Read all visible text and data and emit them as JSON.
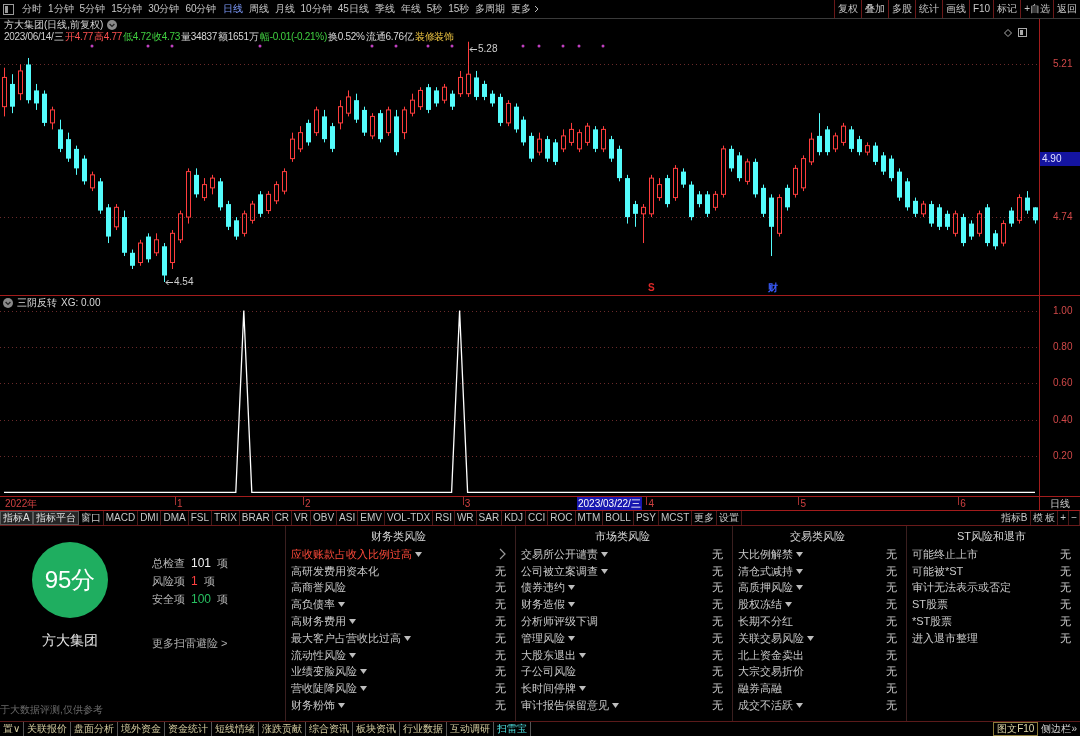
{
  "toolbar": {
    "periods": [
      {
        "label": "分时",
        "selected": false
      },
      {
        "label": "1分钟",
        "selected": false
      },
      {
        "label": "5分钟",
        "selected": false
      },
      {
        "label": "15分钟",
        "selected": false
      },
      {
        "label": "30分钟",
        "selected": false
      },
      {
        "label": "60分钟",
        "selected": false
      },
      {
        "label": "日线",
        "selected": true
      },
      {
        "label": "周线",
        "selected": false
      },
      {
        "label": "月线",
        "selected": false
      },
      {
        "label": "10分钟",
        "selected": false
      },
      {
        "label": "45日线",
        "selected": false
      },
      {
        "label": "季线",
        "selected": false
      },
      {
        "label": "年线",
        "selected": false
      },
      {
        "label": "5秒",
        "selected": false
      },
      {
        "label": "15秒",
        "selected": false
      },
      {
        "label": "多周期",
        "selected": false
      }
    ],
    "more": "更多",
    "actions": [
      "复权",
      "叠加",
      "多股",
      "统计",
      "画线",
      "F10",
      "标记",
      "+自选",
      "返回"
    ]
  },
  "main_pane": {
    "quote_date": "2023/06/14/三",
    "prices": [
      {
        "text": "开4.77",
        "color": "#ff5050"
      },
      {
        "text": "高4.77",
        "color": "#ff5050"
      },
      {
        "text": "低4.72",
        "color": "#40d040"
      },
      {
        "text": "收4.73",
        "color": "#40d040"
      }
    ],
    "trading": [
      {
        "text": "量34837",
        "falling": false
      },
      {
        "text": "额1651万",
        "falling": false
      },
      {
        "text": "幅-0.01(-0.21%)",
        "falling": true
      },
      {
        "text": "换0.52%",
        "falling": false
      },
      {
        "text": "流通6.76亿",
        "falling": false
      }
    ],
    "sector": "装修装饰",
    "cursor_price": "4.90",
    "event_marks": [
      {
        "label": "S",
        "color": "#e02828"
      },
      {
        "label": "财",
        "color": "#3a5cff"
      }
    ],
    "chart_data": [
      {
        "type": "candlestick",
        "title": "方大集团(日线,前复权)",
        "ylim": [
          4.5,
          5.35
        ],
        "yticks": [
          5.21,
          4.74
        ],
        "grid": true,
        "annotations": [
          "5.28",
          "4.54"
        ],
        "ohlc": [
          [
            5.08,
            5.2,
            5.05,
            5.17
          ],
          [
            5.15,
            5.18,
            5.06,
            5.08
          ],
          [
            5.12,
            5.21,
            5.1,
            5.19
          ],
          [
            5.21,
            5.23,
            5.09,
            5.1
          ],
          [
            5.13,
            5.15,
            5.07,
            5.09
          ],
          [
            5.12,
            5.13,
            5.02,
            5.03
          ],
          [
            5.03,
            5.08,
            5.01,
            5.07
          ],
          [
            5.01,
            5.04,
            4.94,
            4.95
          ],
          [
            4.98,
            5.0,
            4.91,
            4.92
          ],
          [
            4.95,
            4.96,
            4.87,
            4.89
          ],
          [
            4.92,
            4.93,
            4.84,
            4.85
          ],
          [
            4.83,
            4.88,
            4.82,
            4.87
          ],
          [
            4.85,
            4.86,
            4.75,
            4.76
          ],
          [
            4.77,
            4.78,
            4.66,
            4.68
          ],
          [
            4.71,
            4.78,
            4.7,
            4.77
          ],
          [
            4.74,
            4.76,
            4.62,
            4.63
          ],
          [
            4.63,
            4.64,
            4.58,
            4.59
          ],
          [
            4.6,
            4.67,
            4.59,
            4.66
          ],
          [
            4.68,
            4.69,
            4.6,
            4.61
          ],
          [
            4.63,
            4.69,
            4.62,
            4.67
          ],
          [
            4.65,
            4.66,
            4.54,
            4.56
          ],
          [
            4.6,
            4.7,
            4.58,
            4.69
          ],
          [
            4.67,
            4.76,
            4.66,
            4.75
          ],
          [
            4.74,
            4.89,
            4.72,
            4.88
          ],
          [
            4.87,
            4.89,
            4.8,
            4.81
          ],
          [
            4.8,
            4.86,
            4.79,
            4.84
          ],
          [
            4.83,
            4.87,
            4.81,
            4.86
          ],
          [
            4.85,
            4.86,
            4.76,
            4.77
          ],
          [
            4.78,
            4.79,
            4.7,
            4.71
          ],
          [
            4.73,
            4.74,
            4.67,
            4.68
          ],
          [
            4.69,
            4.76,
            4.68,
            4.75
          ],
          [
            4.73,
            4.79,
            4.72,
            4.78
          ],
          [
            4.81,
            4.82,
            4.74,
            4.75
          ],
          [
            4.76,
            4.82,
            4.75,
            4.81
          ],
          [
            4.79,
            4.85,
            4.78,
            4.84
          ],
          [
            4.82,
            4.89,
            4.81,
            4.88
          ],
          [
            4.92,
            5.0,
            4.91,
            4.98
          ],
          [
            4.95,
            5.02,
            4.94,
            5.0
          ],
          [
            5.03,
            5.04,
            4.96,
            4.97
          ],
          [
            5.0,
            5.08,
            4.99,
            5.07
          ],
          [
            5.05,
            5.07,
            4.97,
            4.98
          ],
          [
            5.02,
            5.03,
            4.94,
            4.95
          ],
          [
            5.03,
            5.1,
            5.01,
            5.08
          ],
          [
            5.06,
            5.13,
            5.05,
            5.11
          ],
          [
            5.1,
            5.12,
            5.03,
            5.04
          ],
          [
            5.07,
            5.08,
            4.99,
            5.0
          ],
          [
            4.99,
            5.06,
            4.98,
            5.05
          ],
          [
            5.06,
            5.07,
            4.97,
            4.98
          ],
          [
            5.0,
            5.08,
            4.99,
            5.07
          ],
          [
            5.05,
            5.07,
            4.93,
            4.94
          ],
          [
            5.0,
            5.08,
            4.98,
            5.07
          ],
          [
            5.06,
            5.12,
            5.05,
            5.1
          ],
          [
            5.08,
            5.14,
            5.07,
            5.13
          ],
          [
            5.14,
            5.15,
            5.06,
            5.07
          ],
          [
            5.13,
            5.14,
            5.08,
            5.09
          ],
          [
            5.1,
            5.15,
            5.09,
            5.14
          ],
          [
            5.12,
            5.13,
            5.07,
            5.08
          ],
          [
            5.12,
            5.19,
            5.11,
            5.17
          ],
          [
            5.12,
            5.28,
            5.11,
            5.18
          ],
          [
            5.17,
            5.19,
            5.1,
            5.11
          ],
          [
            5.15,
            5.16,
            5.1,
            5.11
          ],
          [
            5.12,
            5.13,
            5.08,
            5.09
          ],
          [
            5.11,
            5.12,
            5.02,
            5.03
          ],
          [
            5.03,
            5.1,
            5.02,
            5.09
          ],
          [
            5.08,
            5.09,
            5.0,
            5.01
          ],
          [
            5.04,
            5.05,
            4.96,
            4.97
          ],
          [
            4.99,
            5.0,
            4.91,
            4.92
          ],
          [
            4.94,
            5.0,
            4.93,
            4.98
          ],
          [
            4.98,
            4.99,
            4.91,
            4.92
          ],
          [
            4.97,
            4.98,
            4.9,
            4.91
          ],
          [
            4.95,
            5.01,
            4.94,
            4.99
          ],
          [
            4.97,
            5.03,
            4.96,
            5.01
          ],
          [
            4.95,
            5.01,
            4.94,
            5.0
          ],
          [
            4.97,
            5.03,
            4.96,
            5.02
          ],
          [
            5.01,
            5.02,
            4.94,
            4.95
          ],
          [
            4.95,
            5.02,
            4.94,
            5.01
          ],
          [
            4.98,
            4.99,
            4.91,
            4.92
          ],
          [
            4.95,
            4.96,
            4.85,
            4.86
          ],
          [
            4.86,
            4.87,
            4.72,
            4.74
          ],
          [
            4.78,
            4.79,
            4.71,
            4.75
          ],
          [
            4.75,
            4.78,
            4.66,
            4.77
          ],
          [
            4.75,
            4.87,
            4.74,
            4.86
          ],
          [
            4.8,
            4.86,
            4.79,
            4.84
          ],
          [
            4.86,
            4.87,
            4.77,
            4.78
          ],
          [
            4.8,
            4.9,
            4.79,
            4.89
          ],
          [
            4.88,
            4.89,
            4.83,
            4.84
          ],
          [
            4.84,
            4.85,
            4.73,
            4.74
          ],
          [
            4.81,
            4.82,
            4.77,
            4.78
          ],
          [
            4.81,
            4.82,
            4.74,
            4.75
          ],
          [
            4.77,
            4.82,
            4.76,
            4.81
          ],
          [
            4.81,
            4.96,
            4.8,
            4.95
          ],
          [
            4.95,
            4.96,
            4.88,
            4.89
          ],
          [
            4.93,
            4.94,
            4.85,
            4.86
          ],
          [
            4.85,
            4.92,
            4.84,
            4.91
          ],
          [
            4.91,
            4.92,
            4.8,
            4.81
          ],
          [
            4.83,
            4.84,
            4.74,
            4.75
          ],
          [
            4.8,
            4.81,
            4.62,
            4.71
          ],
          [
            4.69,
            4.81,
            4.68,
            4.8
          ],
          [
            4.83,
            4.84,
            4.76,
            4.77
          ],
          [
            4.81,
            4.9,
            4.8,
            4.89
          ],
          [
            4.83,
            4.93,
            4.82,
            4.92
          ],
          [
            4.91,
            5.0,
            4.9,
            4.98
          ],
          [
            4.99,
            5.06,
            4.93,
            4.94
          ],
          [
            5.01,
            5.02,
            4.93,
            4.94
          ],
          [
            4.95,
            5.0,
            4.94,
            4.99
          ],
          [
            4.97,
            5.03,
            4.96,
            5.02
          ],
          [
            5.01,
            5.02,
            4.94,
            4.95
          ],
          [
            4.98,
            4.99,
            4.93,
            4.94
          ],
          [
            4.94,
            4.97,
            4.93,
            4.96
          ],
          [
            4.96,
            4.97,
            4.9,
            4.91
          ],
          [
            4.93,
            4.94,
            4.87,
            4.88
          ],
          [
            4.92,
            4.93,
            4.85,
            4.86
          ],
          [
            4.88,
            4.89,
            4.79,
            4.8
          ],
          [
            4.85,
            4.86,
            4.76,
            4.77
          ],
          [
            4.79,
            4.8,
            4.74,
            4.75
          ],
          [
            4.75,
            4.79,
            4.74,
            4.78
          ],
          [
            4.78,
            4.79,
            4.71,
            4.72
          ],
          [
            4.77,
            4.78,
            4.7,
            4.71
          ],
          [
            4.75,
            4.76,
            4.7,
            4.71
          ],
          [
            4.69,
            4.76,
            4.68,
            4.75
          ],
          [
            4.74,
            4.75,
            4.65,
            4.66
          ],
          [
            4.72,
            4.73,
            4.67,
            4.68
          ],
          [
            4.69,
            4.76,
            4.68,
            4.75
          ],
          [
            4.77,
            4.78,
            4.65,
            4.66
          ],
          [
            4.69,
            4.7,
            4.64,
            4.65
          ],
          [
            4.66,
            4.73,
            4.65,
            4.72
          ],
          [
            4.76,
            4.77,
            4.71,
            4.72
          ],
          [
            4.73,
            4.81,
            4.72,
            4.8
          ],
          [
            4.8,
            4.82,
            4.75,
            4.76
          ],
          [
            4.77,
            4.77,
            4.72,
            4.73
          ]
        ]
      }
    ]
  },
  "indicator_pane": {
    "indicator_value": "XG: 0.00",
    "chart_data": [
      {
        "type": "line",
        "title": "三阴反转",
        "ylim": [
          -0.02,
          1.08
        ],
        "yticks": [
          {
            "value": 0.2,
            "label": "0.20"
          },
          {
            "value": 0.4,
            "label": "0.40"
          },
          {
            "value": 0.6,
            "label": "0.60"
          },
          {
            "value": 0.8,
            "label": "0.80"
          },
          {
            "value": 1,
            "label": "1.00"
          }
        ],
        "grid": true,
        "color": "#ffffff",
        "categories": [
          null,
          null,
          null,
          null,
          null,
          null,
          null,
          null,
          null,
          null,
          null,
          null,
          null,
          null,
          null,
          null,
          null,
          null,
          null,
          null,
          null,
          null,
          "1",
          null,
          null,
          null,
          null,
          null,
          null,
          null,
          null,
          null,
          null,
          null,
          null,
          null,
          null,
          null,
          "2",
          null,
          null,
          null,
          null,
          null,
          null,
          null,
          null,
          null,
          null,
          null,
          null,
          null,
          null,
          null,
          null,
          null,
          null,
          null,
          "3",
          null,
          null,
          null,
          null,
          null,
          null,
          null,
          null,
          null,
          null,
          null,
          null,
          null,
          null,
          null,
          null,
          null,
          null,
          null,
          null,
          null,
          null,
          "4",
          null,
          null,
          null,
          null,
          null,
          null,
          null,
          null,
          null,
          null,
          null,
          null,
          null,
          null,
          null,
          null,
          null,
          null,
          "5",
          null,
          null,
          null,
          null,
          null,
          null,
          null,
          null,
          null,
          null,
          null,
          null,
          null,
          null,
          null,
          null,
          null,
          null,
          null,
          "6",
          null,
          null,
          null,
          null,
          null,
          null,
          null,
          null,
          null
        ],
        "values": [
          0,
          0,
          0,
          0,
          0,
          0,
          0,
          0,
          0,
          0,
          0,
          0,
          0,
          0,
          0,
          0,
          0,
          0,
          0,
          0,
          0,
          0,
          0,
          0,
          0,
          0,
          0,
          0,
          0,
          0,
          1,
          0,
          0,
          0,
          0,
          0,
          0,
          0,
          0,
          0,
          0,
          0,
          0,
          0,
          0,
          0,
          0,
          0,
          0,
          0,
          0,
          0,
          0,
          0,
          0,
          0,
          0,
          1,
          0,
          0,
          0,
          0,
          0,
          0,
          0,
          0,
          0,
          0,
          0,
          0,
          0,
          0,
          0,
          0,
          0,
          0,
          0,
          0,
          0,
          0,
          0,
          0,
          0,
          0,
          0,
          0,
          0,
          0,
          0,
          0,
          0,
          0,
          0,
          0,
          0,
          0,
          0,
          0,
          0,
          0,
          0,
          0,
          0,
          0,
          0,
          0,
          0,
          0,
          0,
          0,
          0,
          0,
          0,
          0,
          0,
          0,
          0,
          0,
          0,
          0,
          0,
          0,
          0,
          0,
          0,
          0,
          0,
          0,
          0,
          0
        ]
      }
    ]
  },
  "x_axis": {
    "start_label": "2022年",
    "cursor_date": "2023/03/22/三",
    "period": "日线"
  },
  "indicator_tabs": {
    "items": [
      {
        "label": "指标A",
        "kind": "button"
      },
      {
        "label": "指标平台",
        "kind": "button"
      },
      {
        "label": "窗口",
        "kind": "tab"
      },
      {
        "label": "MACD",
        "kind": "tab"
      },
      {
        "label": "DMI",
        "kind": "tab"
      },
      {
        "label": "DMA",
        "kind": "tab"
      },
      {
        "label": "FSL",
        "kind": "tab"
      },
      {
        "label": "TRIX",
        "kind": "tab"
      },
      {
        "label": "BRAR",
        "kind": "tab"
      },
      {
        "label": "CR",
        "kind": "tab"
      },
      {
        "label": "VR",
        "kind": "tab"
      },
      {
        "label": "OBV",
        "kind": "tab"
      },
      {
        "label": "ASI",
        "kind": "tab"
      },
      {
        "label": "EMV",
        "kind": "tab"
      },
      {
        "label": "VOL-TDX",
        "kind": "tab"
      },
      {
        "label": "RSI",
        "kind": "tab"
      },
      {
        "label": "WR",
        "kind": "tab"
      },
      {
        "label": "SAR",
        "kind": "tab"
      },
      {
        "label": "KDJ",
        "kind": "tab"
      },
      {
        "label": "CCI",
        "kind": "tab"
      },
      {
        "label": "ROC",
        "kind": "tab"
      },
      {
        "label": "MTM",
        "kind": "tab"
      },
      {
        "label": "BOLL",
        "kind": "tab"
      },
      {
        "label": "PSY",
        "kind": "tab"
      },
      {
        "label": "MCST",
        "kind": "tab"
      },
      {
        "label": "更多",
        "kind": "tab"
      },
      {
        "label": "设置",
        "kind": "tab"
      }
    ],
    "right": [
      "指标B",
      "模 板",
      "+",
      "−"
    ]
  },
  "risk_scan": {
    "score": "95分",
    "company": "方大集团",
    "stats": [
      {
        "label": "总检查",
        "value": "101",
        "unit": "项",
        "color": "#f0f0f0"
      },
      {
        "label": "风险项",
        "value": "1",
        "unit": "项",
        "color": "#ff4040"
      },
      {
        "label": "安全项",
        "value": "100",
        "unit": "项",
        "color": "#27c060"
      }
    ],
    "more_link": "更多扫雷避险 >",
    "footnote": "于大数据评测,仅供参考",
    "categories": [
      {
        "title": "财务类风险",
        "items": [
          {
            "name": "应收账款占收入比例过高",
            "expandable": true,
            "flagged": true
          },
          {
            "name": "高研发费用资本化",
            "expandable": false,
            "flagged": false,
            "value": "无"
          },
          {
            "name": "高商誉风险",
            "expandable": false,
            "flagged": false,
            "value": "无"
          },
          {
            "name": "高负债率",
            "expandable": true,
            "flagged": false,
            "value": "无"
          },
          {
            "name": "高财务费用",
            "expandable": true,
            "flagged": false,
            "value": "无"
          },
          {
            "name": "最大客户占营收比过高",
            "expandable": true,
            "flagged": false,
            "value": "无"
          },
          {
            "name": "流动性风险",
            "expandable": true,
            "flagged": false,
            "value": "无"
          },
          {
            "name": "业绩变脸风险",
            "expandable": true,
            "flagged": false,
            "value": "无"
          },
          {
            "name": "营收陡降风险",
            "expandable": true,
            "flagged": false,
            "value": "无"
          },
          {
            "name": "财务粉饰",
            "expandable": true,
            "flagged": false,
            "value": "无"
          }
        ]
      },
      {
        "title": "市场类风险",
        "items": [
          {
            "name": "交易所公开谴责",
            "expandable": true,
            "flagged": false,
            "value": "无"
          },
          {
            "name": "公司被立案调查",
            "expandable": true,
            "flagged": false,
            "value": "无"
          },
          {
            "name": "债券违约",
            "expandable": true,
            "flagged": false,
            "value": "无"
          },
          {
            "name": "财务造假",
            "expandable": true,
            "flagged": false,
            "value": "无"
          },
          {
            "name": "分析师评级下调",
            "expandable": false,
            "flagged": false,
            "value": "无"
          },
          {
            "name": "管理风险",
            "expandable": true,
            "flagged": false,
            "value": "无"
          },
          {
            "name": "大股东退出",
            "expandable": true,
            "flagged": false,
            "value": "无"
          },
          {
            "name": "子公司风险",
            "expandable": false,
            "flagged": false,
            "value": "无"
          },
          {
            "name": "长时间停牌",
            "expandable": true,
            "flagged": false,
            "value": "无"
          },
          {
            "name": "审计报告保留意见",
            "expandable": true,
            "flagged": false,
            "value": "无"
          }
        ]
      },
      {
        "title": "交易类风险",
        "items": [
          {
            "name": "大比例解禁",
            "expandable": true,
            "flagged": false,
            "value": "无"
          },
          {
            "name": "清仓式减持",
            "expandable": true,
            "flagged": false,
            "value": "无"
          },
          {
            "name": "高质押风险",
            "expandable": true,
            "flagged": false,
            "value": "无"
          },
          {
            "name": "股权冻结",
            "expandable": true,
            "flagged": false,
            "value": "无"
          },
          {
            "name": "长期不分红",
            "expandable": false,
            "flagged": false,
            "value": "无"
          },
          {
            "name": "关联交易风险",
            "expandable": true,
            "flagged": false,
            "value": "无"
          },
          {
            "name": "北上资金卖出",
            "expandable": false,
            "flagged": false,
            "value": "无"
          },
          {
            "name": "大宗交易折价",
            "expandable": false,
            "flagged": false,
            "value": "无"
          },
          {
            "name": "融券高融",
            "expandable": false,
            "flagged": false,
            "value": "无"
          },
          {
            "name": "成交不活跃",
            "expandable": true,
            "flagged": false,
            "value": "无"
          }
        ]
      },
      {
        "title": "ST风险和退市",
        "items": [
          {
            "name": "可能终止上市",
            "expandable": false,
            "flagged": false,
            "value": "无"
          },
          {
            "name": "可能被*ST",
            "expandable": false,
            "flagged": false,
            "value": "无"
          },
          {
            "name": "审计无法表示或否定",
            "expandable": false,
            "flagged": false,
            "value": "无"
          },
          {
            "name": "ST股票",
            "expandable": false,
            "flagged": false,
            "value": "无"
          },
          {
            "name": "*ST股票",
            "expandable": false,
            "flagged": false,
            "value": "无"
          },
          {
            "name": "进入退市整理",
            "expandable": false,
            "flagged": false,
            "value": "无"
          }
        ]
      }
    ]
  },
  "bottom_tabs": {
    "items": [
      {
        "label": "置∨",
        "selected": false
      },
      {
        "label": "关联报价",
        "selected": false
      },
      {
        "label": "盘面分析",
        "selected": false
      },
      {
        "label": "境外资金",
        "selected": false
      },
      {
        "label": "资金统计",
        "selected": false
      },
      {
        "label": "短线情绪",
        "selected": false
      },
      {
        "label": "涨跌贡献",
        "selected": false
      },
      {
        "label": "综合资讯",
        "selected": false
      },
      {
        "label": "板块资讯",
        "selected": false
      },
      {
        "label": "行业数据",
        "selected": false
      },
      {
        "label": "互动调研",
        "selected": false
      },
      {
        "label": "扫雷宝",
        "selected": true
      }
    ],
    "right": [
      {
        "label": "图文F10",
        "kind": "boxed"
      },
      {
        "label": "侧边栏»",
        "kind": "plain"
      }
    ]
  }
}
